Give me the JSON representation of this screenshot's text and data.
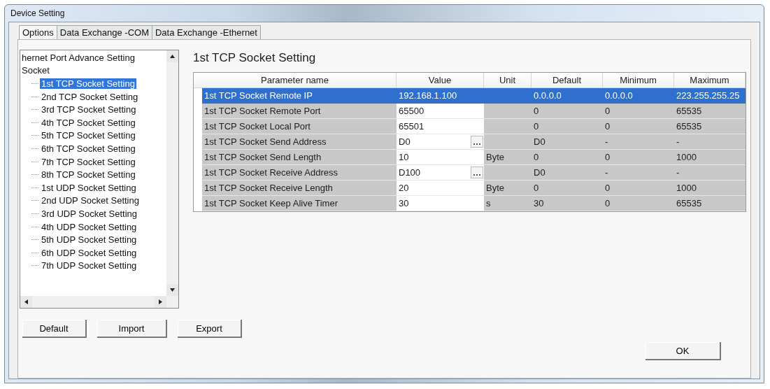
{
  "window": {
    "title": "Device Setting"
  },
  "tabs": [
    {
      "label": "Options",
      "selected": true
    },
    {
      "label": "Data Exchange -COM",
      "selected": false
    },
    {
      "label": "Data Exchange -Ethernet",
      "selected": false
    }
  ],
  "tree": [
    {
      "label": "hernet Port Advance Setting",
      "selected": false
    },
    {
      "label": "Socket",
      "selected": false,
      "children": [
        {
          "label": "1st TCP Socket Setting",
          "selected": true
        },
        {
          "label": "2nd TCP Socket Setting",
          "selected": false
        },
        {
          "label": "3rd TCP Socket Setting",
          "selected": false
        },
        {
          "label": "4th TCP Socket Setting",
          "selected": false
        },
        {
          "label": "5th TCP Socket Setting",
          "selected": false
        },
        {
          "label": "6th TCP Socket Setting",
          "selected": false
        },
        {
          "label": "7th TCP Socket Setting",
          "selected": false
        },
        {
          "label": "8th TCP Socket Setting",
          "selected": false
        },
        {
          "label": "1st UDP Socket Setting",
          "selected": false
        },
        {
          "label": "2nd UDP Socket Setting",
          "selected": false
        },
        {
          "label": "3rd UDP Socket Setting",
          "selected": false
        },
        {
          "label": "4th UDP Socket Setting",
          "selected": false
        },
        {
          "label": "5th UDP Socket Setting",
          "selected": false
        },
        {
          "label": "6th UDP Socket Setting",
          "selected": false
        },
        {
          "label": "7th UDP Socket Setting",
          "selected": false
        }
      ]
    }
  ],
  "section_title": "1st TCP Socket Setting",
  "table": {
    "columns": [
      "Parameter name",
      "Value",
      "Unit",
      "Default",
      "Minimum",
      "Maximum"
    ],
    "rows": [
      {
        "cells": [
          "1st TCP Socket Remote IP",
          "192.168.1.100",
          "",
          "0.0.0.0",
          "0.0.0.0",
          "223.255.255.25"
        ],
        "selected": true,
        "browse": false
      },
      {
        "cells": [
          "1st TCP Socket Remote Port",
          "65500",
          "",
          "0",
          "0",
          "65535"
        ],
        "selected": false,
        "browse": false
      },
      {
        "cells": [
          "1st TCP Socket Local Port",
          "65501",
          "",
          "0",
          "0",
          "65535"
        ],
        "selected": false,
        "browse": false
      },
      {
        "cells": [
          "1st TCP Socket Send Address",
          "D0",
          "",
          "D0",
          "-",
          "-"
        ],
        "selected": false,
        "browse": true
      },
      {
        "cells": [
          "1st TCP Socket Send Length",
          "10",
          "Byte",
          "0",
          "0",
          "1000"
        ],
        "selected": false,
        "browse": false
      },
      {
        "cells": [
          "1st TCP Socket Receive Address",
          "D100",
          "",
          "D0",
          "-",
          "-"
        ],
        "selected": false,
        "browse": true
      },
      {
        "cells": [
          "1st TCP Socket Receive Length",
          "20",
          "Byte",
          "0",
          "0",
          "1000"
        ],
        "selected": false,
        "browse": false
      },
      {
        "cells": [
          "1st TCP Socket Keep Alive Timer",
          "30",
          "s",
          "30",
          "0",
          "65535"
        ],
        "selected": false,
        "browse": false
      }
    ]
  },
  "buttons": [
    "Default",
    "Import",
    "Export"
  ],
  "ok_button": "OK"
}
